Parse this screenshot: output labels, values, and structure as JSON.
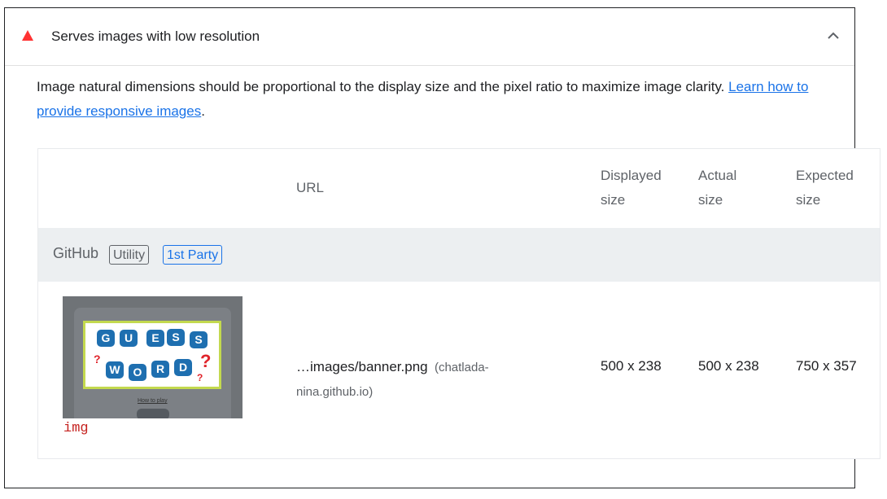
{
  "audit": {
    "title": "Serves images with low resolution",
    "description": "Image natural dimensions should be proportional to the display size and the pixel ratio to maximize image clarity. ",
    "learn_more": "Learn how to provide responsive images",
    "period": ".",
    "status_color": "#ff3333",
    "link_color": "#1a73e8"
  },
  "table": {
    "headers": {
      "url": "URL",
      "displayed": [
        "Displayed",
        "size"
      ],
      "actual": [
        "Actual",
        "size"
      ],
      "expected": [
        "Expected",
        "size"
      ]
    },
    "group": {
      "name": "GitHub",
      "badges": [
        "Utility",
        "1st Party"
      ]
    },
    "rows": [
      {
        "thumbnail": {
          "tiles_row1": [
            "G",
            "U",
            "E",
            "S",
            "S"
          ],
          "tiles_row2": [
            "W",
            "O",
            "R",
            "D"
          ],
          "qmark": "?",
          "link_text": "How to play"
        },
        "element": "img",
        "url": "…images/banner.png",
        "host": "(chatlada-nina.github.io)",
        "displayed_size": "500 x 238",
        "actual_size": "500 x 238",
        "expected_size": "750 x 357"
      }
    ]
  }
}
